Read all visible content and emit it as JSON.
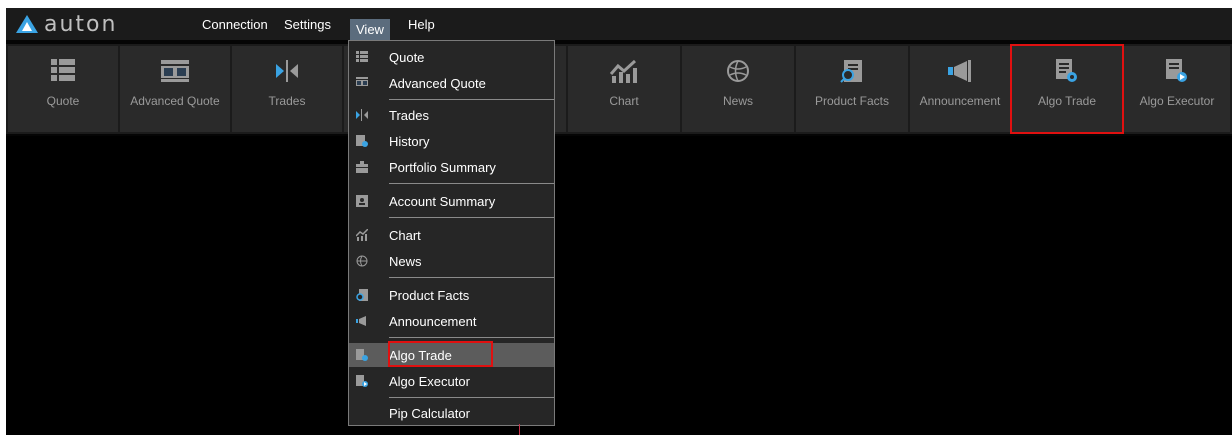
{
  "app": {
    "logo_text": "auton",
    "brand_color": "#3aa3e3"
  },
  "menubar": {
    "items": [
      "Connection",
      "Settings",
      "View",
      "Help"
    ],
    "active": "View"
  },
  "toolbar": {
    "buttons": [
      {
        "label": "Quote",
        "icon": "quote-icon"
      },
      {
        "label": "Advanced Quote",
        "icon": "advanced-quote-icon"
      },
      {
        "label": "Trades",
        "icon": "trades-icon"
      },
      {
        "label": "Chart",
        "icon": "chart-icon"
      },
      {
        "label": "News",
        "icon": "news-icon"
      },
      {
        "label": "Product Facts",
        "icon": "product-facts-icon"
      },
      {
        "label": "Announcement",
        "icon": "announcement-icon"
      },
      {
        "label": "Algo Trade",
        "icon": "algo-trade-icon",
        "highlighted": true
      },
      {
        "label": "Algo Executor",
        "icon": "algo-executor-icon"
      }
    ]
  },
  "view_menu": {
    "items": [
      {
        "label": "Quote",
        "icon": "quote-icon"
      },
      {
        "label": "Advanced Quote",
        "icon": "advanced-quote-icon"
      },
      {
        "label": "Trades",
        "icon": "trades-icon"
      },
      {
        "label": "History",
        "icon": "history-icon"
      },
      {
        "label": "Portfolio Summary",
        "icon": "portfolio-icon"
      },
      {
        "label": "Account Summary",
        "icon": "account-icon"
      },
      {
        "label": "Chart",
        "icon": "chart-icon"
      },
      {
        "label": "News",
        "icon": "news-icon"
      },
      {
        "label": "Product Facts",
        "icon": "product-facts-icon"
      },
      {
        "label": "Announcement",
        "icon": "announcement-icon"
      },
      {
        "label": "Algo Trade",
        "icon": "algo-trade-icon",
        "selected": true
      },
      {
        "label": "Algo Executor",
        "icon": "algo-executor-icon"
      },
      {
        "label": "Pip Calculator",
        "icon": ""
      }
    ]
  },
  "colors": {
    "highlight": "#e01010",
    "menu_active_bg": "#5b6c7d"
  }
}
